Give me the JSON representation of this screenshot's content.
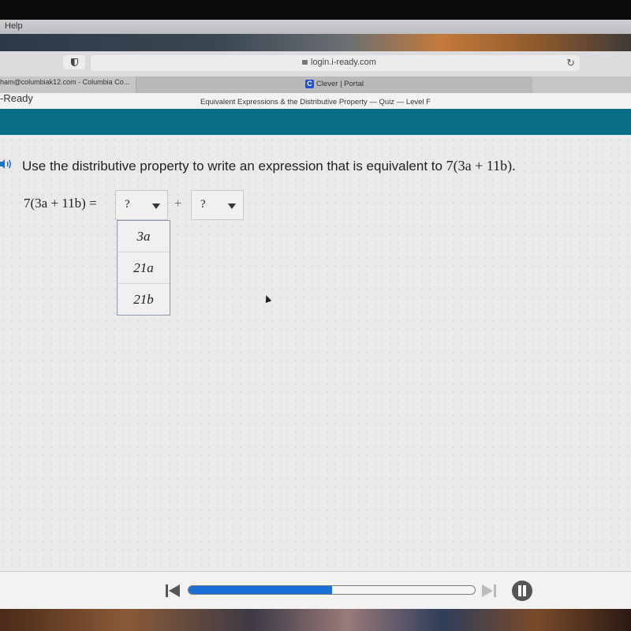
{
  "menubar": {
    "help": "Help"
  },
  "browser": {
    "url": "login.i-ready.com",
    "tabs": [
      {
        "label": "ham@columbiak12.com - Columbia Co..."
      },
      {
        "label": "Clever | Portal",
        "icon": "C"
      }
    ]
  },
  "app": {
    "brand": "-Ready",
    "quiz_title": "Equivalent Expressions & the Distributive Property — Quiz — Level F",
    "accent_color": "#0b6d85"
  },
  "question": {
    "prompt": "Use the distributive property to write an expression that is equivalent to ",
    "prompt_math": "7(3a + 11b).",
    "lhs": "7(3a + 11b) =",
    "plus": "+",
    "dropdown1": {
      "value": "?",
      "options": [
        "3a",
        "21a",
        "21b"
      ]
    },
    "dropdown2": {
      "value": "?"
    }
  },
  "player": {
    "progress_percent": 50,
    "progress_color": "#1a6fd6"
  }
}
